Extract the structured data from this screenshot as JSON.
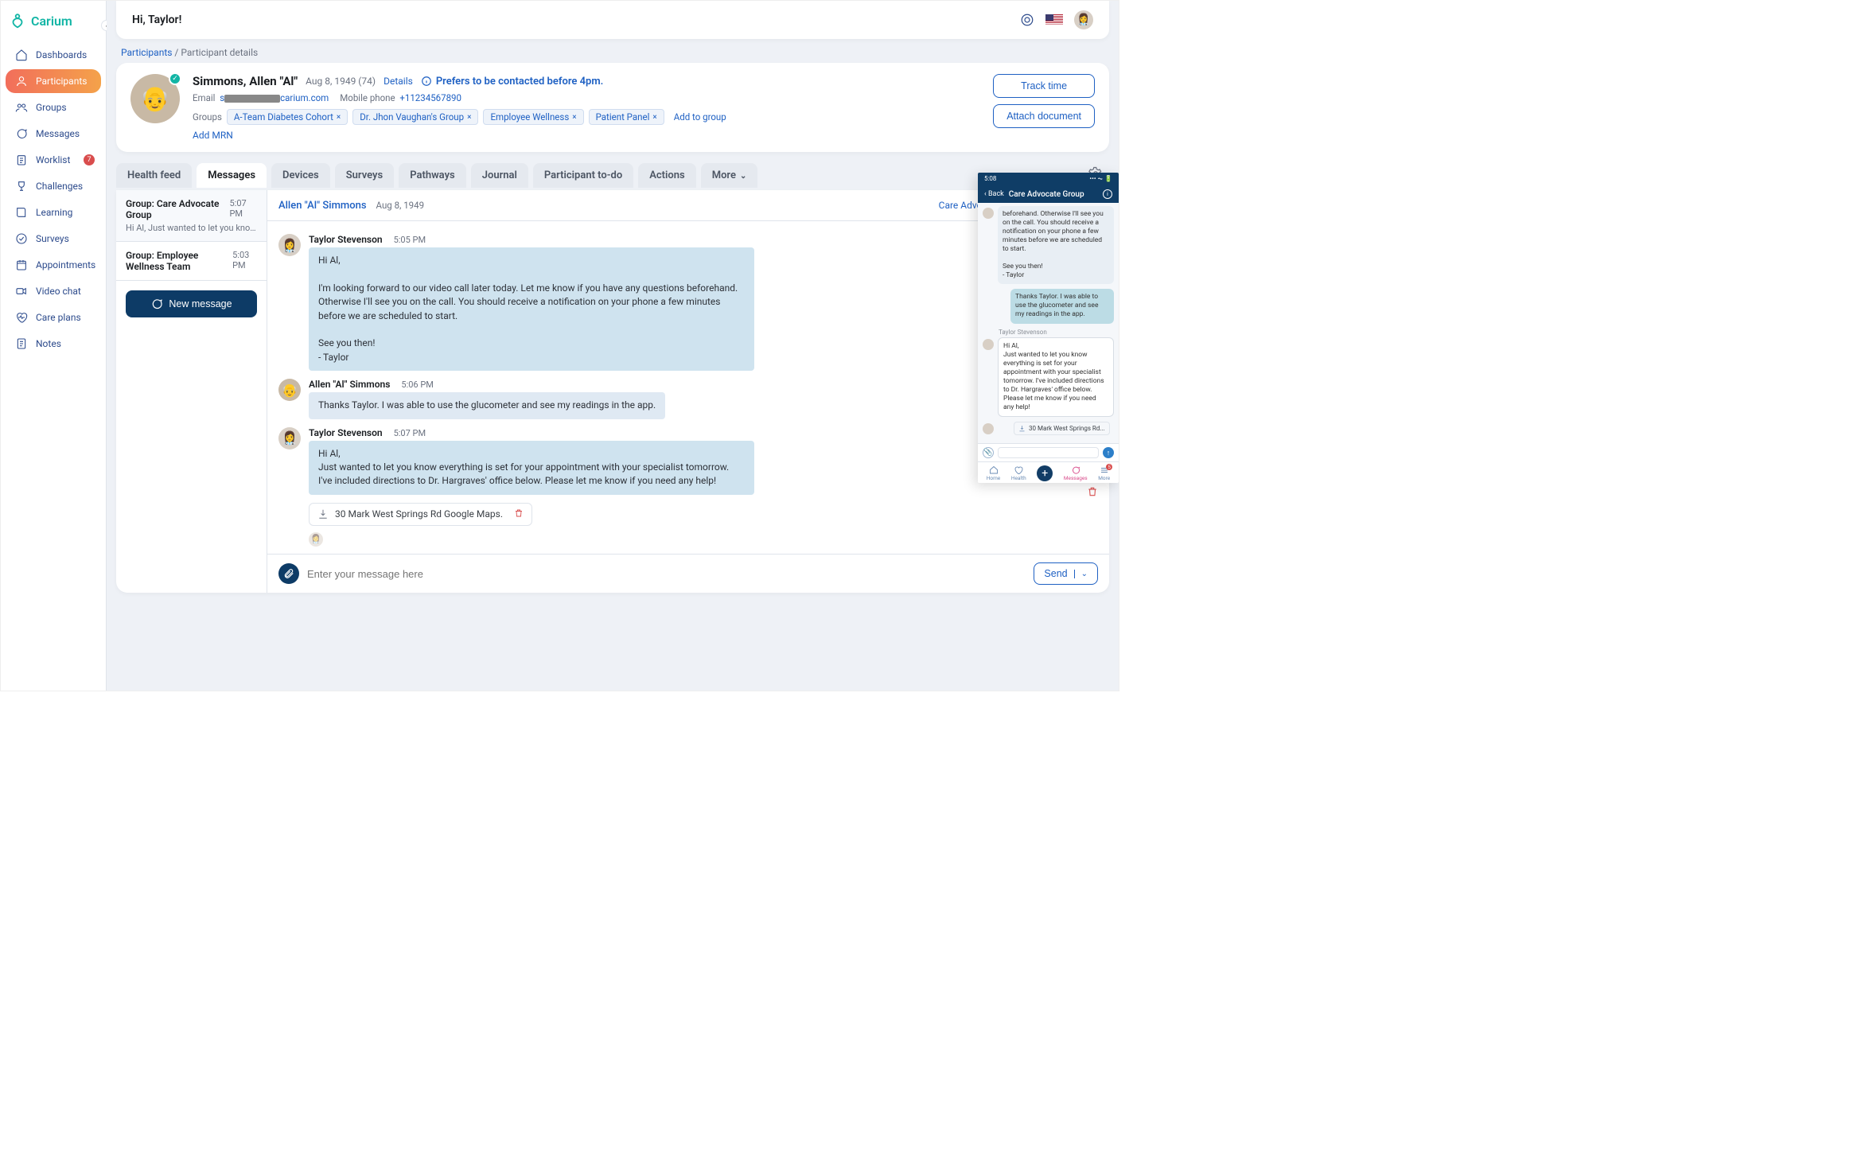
{
  "brand": {
    "name": "Carium"
  },
  "sidebar": {
    "items": [
      {
        "label": "Dashboards"
      },
      {
        "label": "Participants"
      },
      {
        "label": "Groups"
      },
      {
        "label": "Messages"
      },
      {
        "label": "Worklist",
        "badge": "7"
      },
      {
        "label": "Challenges"
      },
      {
        "label": "Learning"
      },
      {
        "label": "Surveys"
      },
      {
        "label": "Appointments"
      },
      {
        "label": "Video chat"
      },
      {
        "label": "Care plans"
      },
      {
        "label": "Notes"
      }
    ]
  },
  "topbar": {
    "greeting": "Hi, Taylor!"
  },
  "breadcrumb": {
    "parent": "Participants",
    "sep": " / ",
    "current": "Participant details"
  },
  "patient": {
    "name": "Simmons, Allen \"Al\"",
    "dob": "Aug 8, 1949 (74)",
    "details": "Details",
    "pref": "Prefers to be contacted before 4pm.",
    "email_label": "Email",
    "email_prefix": "s",
    "email_suffix": "carium.com",
    "phone_label": "Mobile phone",
    "phone": "+11234567890",
    "groups_label": "Groups",
    "groups": [
      "A-Team Diabetes Cohort",
      "Dr. Jhon Vaughan's Group",
      "Employee Wellness",
      "Patient Panel"
    ],
    "add_group": "Add to group",
    "add_mrn": "Add MRN",
    "track_time": "Track time",
    "attach_doc": "Attach document"
  },
  "tabs": {
    "list": [
      "Health feed",
      "Messages",
      "Devices",
      "Surveys",
      "Pathways",
      "Journal",
      "Participant to-do",
      "Actions",
      "More"
    ]
  },
  "threads": {
    "items": [
      {
        "title": "Group: Care Advocate Group",
        "time": "5:07 PM",
        "preview": "Hi Al, Just wanted to let you know everything is s..."
      },
      {
        "title": "Group: Employee Wellness Team",
        "time": "5:03 PM",
        "preview": ""
      }
    ],
    "new_btn": "New message"
  },
  "conv": {
    "name": "Allen \"Al\" Simmons",
    "dob": "Aug 8, 1949",
    "group": "Care Advocate Group"
  },
  "messages": {
    "m0": {
      "sender": "Taylor Stevenson",
      "time": "5:05 PM",
      "text": "Hi Al,\n\nI'm looking forward to our video call later today. Let me know if you have any questions beforehand. Otherwise I'll see you on the call. You should receive a notification on your phone a few minutes before we are scheduled to start.\n\nSee you then!\n- Taylor"
    },
    "m1": {
      "sender": "Allen \"Al\" Simmons",
      "time": "5:06 PM",
      "text": "Thanks Taylor. I was able to use the glucometer and see my readings in the app."
    },
    "m2": {
      "sender": "Taylor Stevenson",
      "time": "5:07 PM",
      "text": "Hi Al,\nJust wanted to let you know everything is set for your appointment with your specialist tomorrow. I've included directions to Dr. Hargraves' office below. Please let me know if you need any help!"
    },
    "attachment": "30 Mark West Springs Rd Google Maps."
  },
  "composer": {
    "placeholder": "Enter your message here",
    "send": "Send"
  },
  "mobile": {
    "time": "5:08",
    "back": "Back",
    "title": "Care Advocate Group",
    "bubble0": "beforehand. Otherwise I'll see you on the call. You should receive a notification on your phone a few minutes before we are scheduled to start.\n\nSee you then!\n- Taylor",
    "bubble1": "Thanks Taylor. I was able to use the glucometer and see my readings in the app.",
    "name2": "Taylor Stevenson",
    "bubble2": "Hi Al,\nJust wanted to let you know everything is set for your appointment with your specialist tomorrow. I've included directions to Dr. Hargraves' office below. Please let me know if you need any help!",
    "attachment": "30 Mark West Springs Rd...",
    "nav": {
      "home": "Home",
      "health": "Health",
      "messages": "Messages",
      "more": "More",
      "badge": "5"
    }
  }
}
